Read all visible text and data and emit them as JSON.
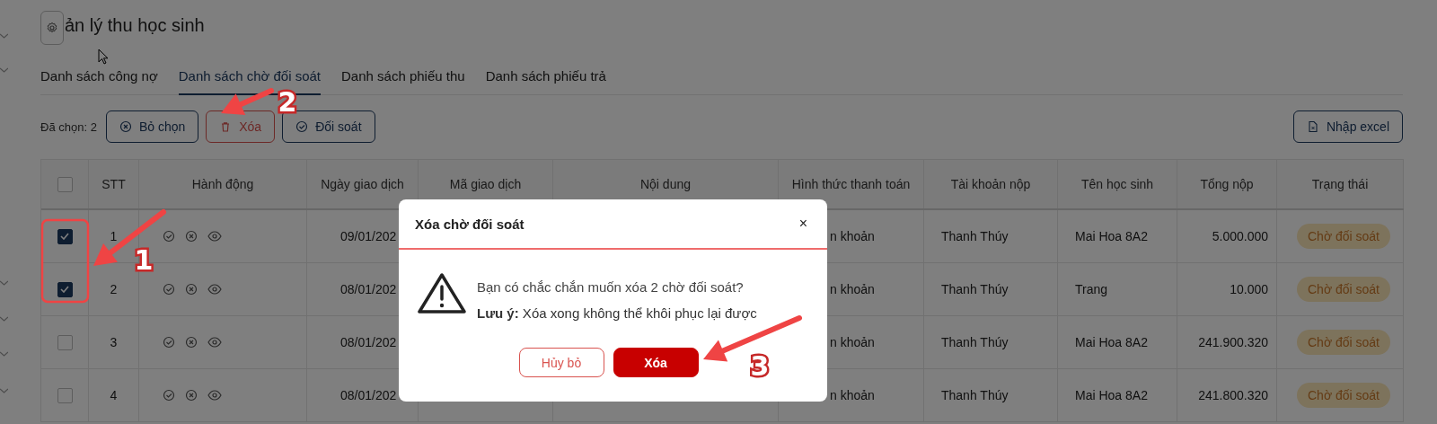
{
  "title": "ản lý thu học sinh",
  "tabs": [
    {
      "label": "Danh sách công nợ",
      "selected": false
    },
    {
      "label": "Danh sách chờ đối soát",
      "selected": true
    },
    {
      "label": "Danh sách phiếu thu",
      "selected": false
    },
    {
      "label": "Danh sách phiếu trả",
      "selected": false
    }
  ],
  "toolbar": {
    "selection": "Đã chọn: 2",
    "actions": [
      {
        "kind": "deselect",
        "label": "Bỏ chọn"
      },
      {
        "kind": "delete",
        "label": "Xóa"
      },
      {
        "kind": "reconcile",
        "label": "Đối soát"
      }
    ],
    "import": {
      "label": "Nhập excel"
    }
  },
  "table": {
    "select_all_checked": false,
    "columns": [
      "STT",
      "Hành động",
      "Ngày giao dịch",
      "Mã giao dịch",
      "Nội dung",
      "Hình thức thanh toán",
      "Tài khoản nộp",
      "Tên học sinh",
      "Tổng nộp",
      "Trạng thái"
    ],
    "rows": [
      {
        "checked": true,
        "stt": "1",
        "date": "09/01/202",
        "payment_method": "n khoản",
        "account": "Thanh Thúy",
        "student": "Mai Hoa 8A2",
        "total": "5.000.000",
        "status": "Chờ đối soát"
      },
      {
        "checked": true,
        "stt": "2",
        "date": "08/01/202",
        "payment_method": "n khoản",
        "account": "Thanh Thúy",
        "student": "Trang",
        "total": "10.000",
        "status": "Chờ đối soát"
      },
      {
        "checked": false,
        "stt": "3",
        "date": "08/01/202",
        "payment_method": "n khoản",
        "account": "Thanh Thúy",
        "student": "Mai Hoa 8A2",
        "total": "241.900.320",
        "status": "Chờ đối soát"
      },
      {
        "checked": false,
        "stt": "4",
        "date": "08/01/202",
        "payment_method": "n khoản",
        "account": "Thanh Thúy",
        "student": "Mai Hoa 8A2",
        "total": "241.800.320",
        "status": "Chờ đối soát"
      }
    ]
  },
  "dialog": {
    "title": "Xóa chờ đối soát",
    "close": "×",
    "message": "Bạn có chắc chắn muốn xóa 2 chờ đối soát?",
    "note": "**Lưu ý:** Xóa xong không thể khôi phục lại được",
    "buttons": [
      {
        "kind": "cancel",
        "label": "Hủy bỏ"
      },
      {
        "kind": "confirm",
        "label": "Xóa"
      }
    ]
  },
  "annotations": [
    {
      "kind": "frame"
    },
    {
      "kind": "arrow",
      "label": "1"
    },
    {
      "kind": "arrow",
      "label": "2"
    },
    {
      "kind": "arrow",
      "label": "3"
    }
  ]
}
